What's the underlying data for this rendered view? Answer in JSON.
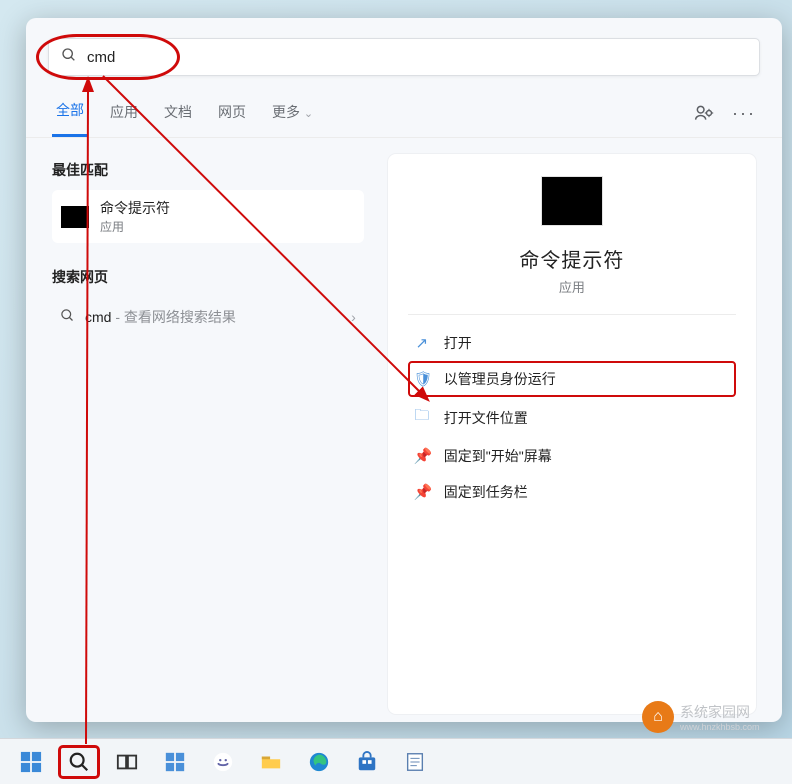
{
  "search": {
    "value": "cmd",
    "placeholder": ""
  },
  "tabs": {
    "all": "全部",
    "apps": "应用",
    "docs": "文档",
    "web": "网页",
    "more": "更多"
  },
  "sections": {
    "best_match": "最佳匹配",
    "search_web": "搜索网页"
  },
  "best": {
    "title": "命令提示符",
    "subtitle": "应用"
  },
  "web": {
    "query": "cmd",
    "desc": " - 查看网络搜索结果"
  },
  "preview": {
    "title": "命令提示符",
    "subtitle": "应用"
  },
  "actions": {
    "open": "打开",
    "run_admin": "以管理员身份运行",
    "open_location": "打开文件位置",
    "pin_start": "固定到\"开始\"屏幕",
    "pin_taskbar": "固定到任务栏"
  },
  "watermark": {
    "brand": "系统家园网",
    "url": "www.hnzkhbsb.com"
  }
}
